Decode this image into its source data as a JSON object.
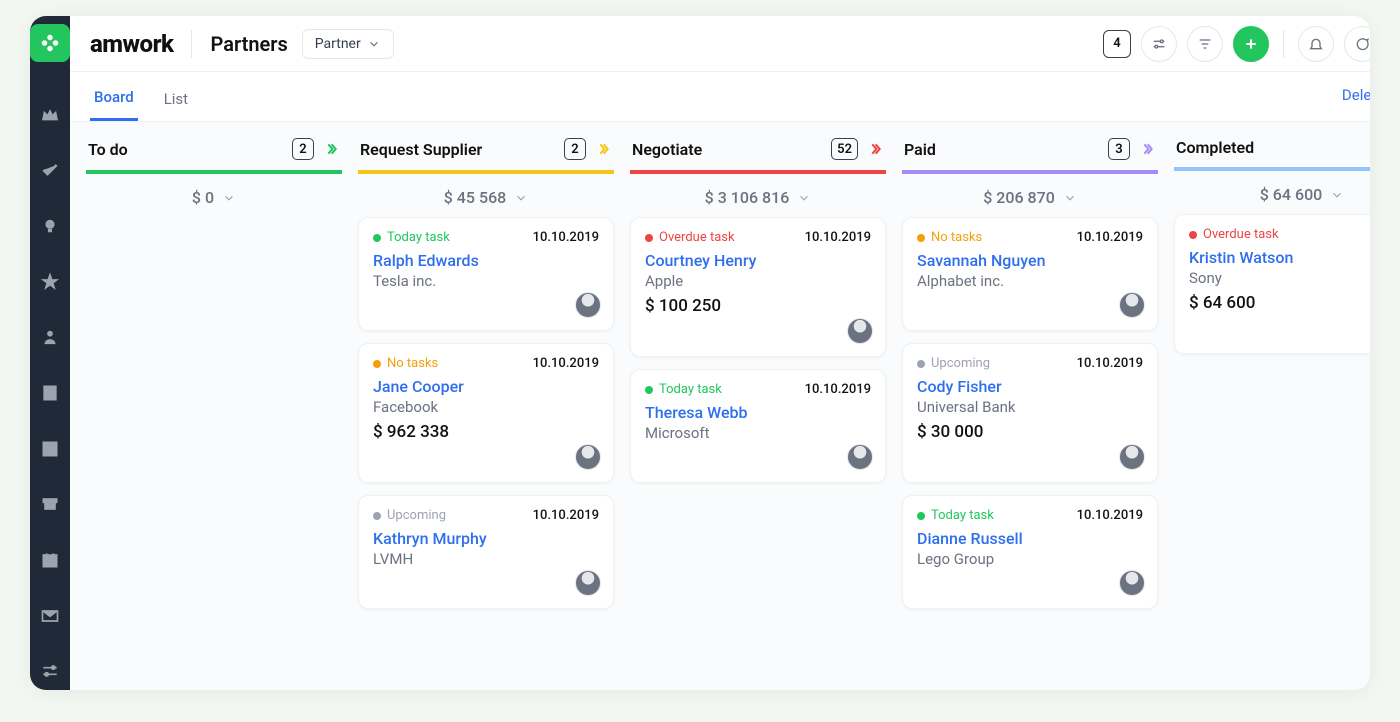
{
  "brand": "amwork",
  "section": "Partners",
  "dropdown_label": "Partner",
  "top_badge": "4",
  "tabs": {
    "board": "Board",
    "list": "List"
  },
  "delete_demo": "Delete demo",
  "status_labels": {
    "today": "Today task",
    "overdue": "Overdue task",
    "notasks": "No tasks",
    "upcoming": "Upcoming"
  },
  "columns": [
    {
      "key": "todo",
      "title": "To do",
      "count": "2",
      "color": "#22c55e",
      "arrow_color": "#22c55e",
      "total": "$ 0",
      "cards": []
    },
    {
      "key": "request",
      "title": "Request Supplier",
      "count": "2",
      "color": "#f5c518",
      "arrow_color": "#f5c518",
      "total": "$ 45 568",
      "cards": [
        {
          "status": "today",
          "status_color": "green",
          "date": "10.10.2019",
          "name": "Ralph Edwards",
          "company": "Tesla inc.",
          "amount": ""
        },
        {
          "status": "notasks",
          "status_color": "orange",
          "date": "10.10.2019",
          "name": "Jane Cooper",
          "company": "Facebook",
          "amount": "$ 962 338"
        },
        {
          "status": "upcoming",
          "status_color": "gray",
          "date": "10.10.2019",
          "name": "Kathryn Murphy",
          "company": "LVMH",
          "amount": ""
        }
      ]
    },
    {
      "key": "negotiate",
      "title": "Negotiate",
      "count": "52",
      "color": "#ef4444",
      "arrow_color": "#ef4444",
      "total": "$ 3 106 816",
      "cards": [
        {
          "status": "overdue",
          "status_color": "red",
          "date": "10.10.2019",
          "name": "Courtney Henry",
          "company": "Apple",
          "amount": "$ 100 250"
        },
        {
          "status": "today",
          "status_color": "green",
          "date": "10.10.2019",
          "name": "Theresa Webb",
          "company": "Microsoft",
          "amount": ""
        }
      ]
    },
    {
      "key": "paid",
      "title": "Paid",
      "count": "3",
      "color": "#a78bfa",
      "arrow_color": "#a78bfa",
      "total": "$ 206 870",
      "cards": [
        {
          "status": "notasks",
          "status_color": "orange",
          "date": "10.10.2019",
          "name": "Savannah Nguyen",
          "company": "Alphabet inc.",
          "amount": ""
        },
        {
          "status": "upcoming",
          "status_color": "gray",
          "date": "10.10.2019",
          "name": "Cody Fisher",
          "company": "Universal Bank",
          "amount": "$ 30 000"
        },
        {
          "status": "today",
          "status_color": "green",
          "date": "10.10.2019",
          "name": "Dianne Russell",
          "company": "Lego Group",
          "amount": ""
        }
      ]
    },
    {
      "key": "completed",
      "title": "Completed",
      "count": "",
      "color": "#93c5fd",
      "arrow_color": "",
      "total": "$ 64 600",
      "cards": [
        {
          "status": "overdue",
          "status_color": "red",
          "date": "",
          "name": "Kristin Watson",
          "company": "Sony",
          "amount": "$ 64 600"
        }
      ]
    }
  ]
}
